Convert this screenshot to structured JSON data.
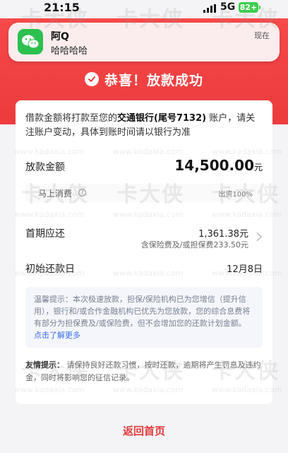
{
  "status_bar": {
    "time": "21:15",
    "network": "5G",
    "battery": "82+"
  },
  "notification": {
    "app": "WeChat",
    "sender": "阿Q",
    "message": "哈哈哈哈",
    "time": "现在"
  },
  "header": {
    "title": "恭喜！放款成功"
  },
  "card": {
    "intro_pre": "借款金额将打款至您的",
    "intro_bank": "交通银行(尾号7132)",
    "intro_post": "账户，请关注账户变动，具体到账时间请以银行为准",
    "loan_label": "放款金额",
    "loan_amount": "14,500.00",
    "loan_unit": "元",
    "consume_label": "马上消费",
    "consume_value": "出资100%",
    "first_label": "首期应还",
    "first_amount": "1,361.38元",
    "first_sub": "含保险费及/或担保费233.50元",
    "first_date_label": "初始还款日",
    "first_date": "12月8日",
    "tip_text": "温馨提示：本次极速放款，担保/保险机构已为您增信（提升信用），银行和/或合作金融机构已优先为您放款，您的综合息费将有部分为担保费及/或保险费，但不会增加您的还款计划金额。",
    "tip_link": "点击了解更多",
    "friendly_label": "友情提示：",
    "friendly_text": "请保持良好还款习惯，按时还款，逾期将产生罚息及违约金，同时将影响您的征信记录。"
  },
  "footer": {
    "home_button": "返回首页"
  },
  "watermark": {
    "big": "卡大侠",
    "small": "www.kadaxia.com"
  },
  "colors": {
    "accent_red": "#ec3b3c",
    "link_blue": "#3a6fe6",
    "wechat_green": "#2dc04f"
  }
}
